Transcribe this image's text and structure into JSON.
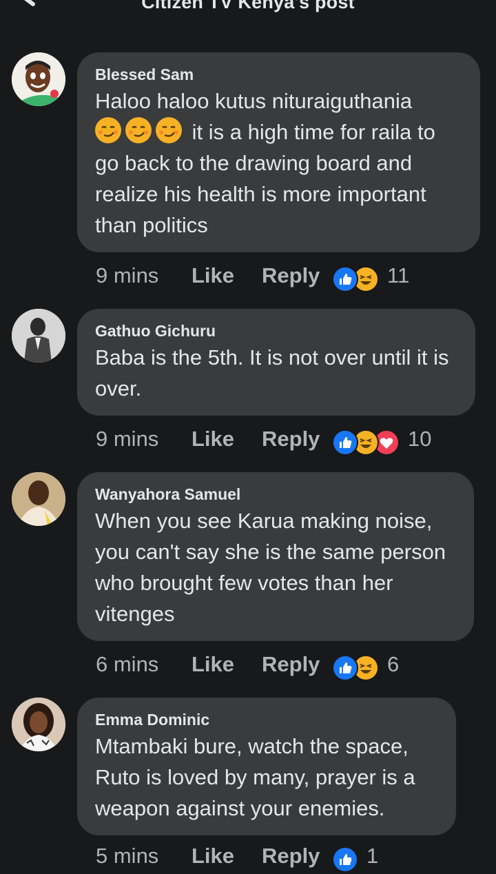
{
  "header": {
    "title": "Citizen TV Kenya's post"
  },
  "comments": [
    {
      "author": "Blessed Sam",
      "text_line1": "Haloo haloo kutus nituraiguthania",
      "text_line2": "it is a high time for raila to",
      "text_rest": "go back to the drawing board and realize his health is more important than politics",
      "time": "9 mins",
      "like_label": "Like",
      "reply_label": "Reply",
      "reactions": [
        "like-icon",
        "haha-icon"
      ],
      "reaction_count": "11"
    },
    {
      "author": "Gathuo Gichuru",
      "text": "Baba is the 5th. It is not over until it is over.",
      "time": "9 mins",
      "like_label": "Like",
      "reply_label": "Reply",
      "reactions": [
        "like-icon",
        "haha-icon",
        "love-icon"
      ],
      "reaction_count": "10"
    },
    {
      "author": "Wanyahora Samuel",
      "text": "When you see Karua making noise, you can't say she is the same person who brought few votes than her vitenges",
      "time": "6 mins",
      "like_label": "Like",
      "reply_label": "Reply",
      "reactions": [
        "like-icon",
        "haha-icon"
      ],
      "reaction_count": "6"
    },
    {
      "author": "Emma Dominic",
      "text": "Mtambaki bure, watch the space, Ruto is loved by many, prayer is a weapon  against your enemies.",
      "time": "5 mins",
      "like_label": "Like",
      "reply_label": "Reply",
      "reactions": [
        "like-icon"
      ],
      "reaction_count": "1"
    }
  ],
  "colors": {
    "background": "#18191a",
    "bubble": "#3a3b3c",
    "like": "#1877f2",
    "haha": "#f7b125",
    "love": "#f33e58"
  }
}
